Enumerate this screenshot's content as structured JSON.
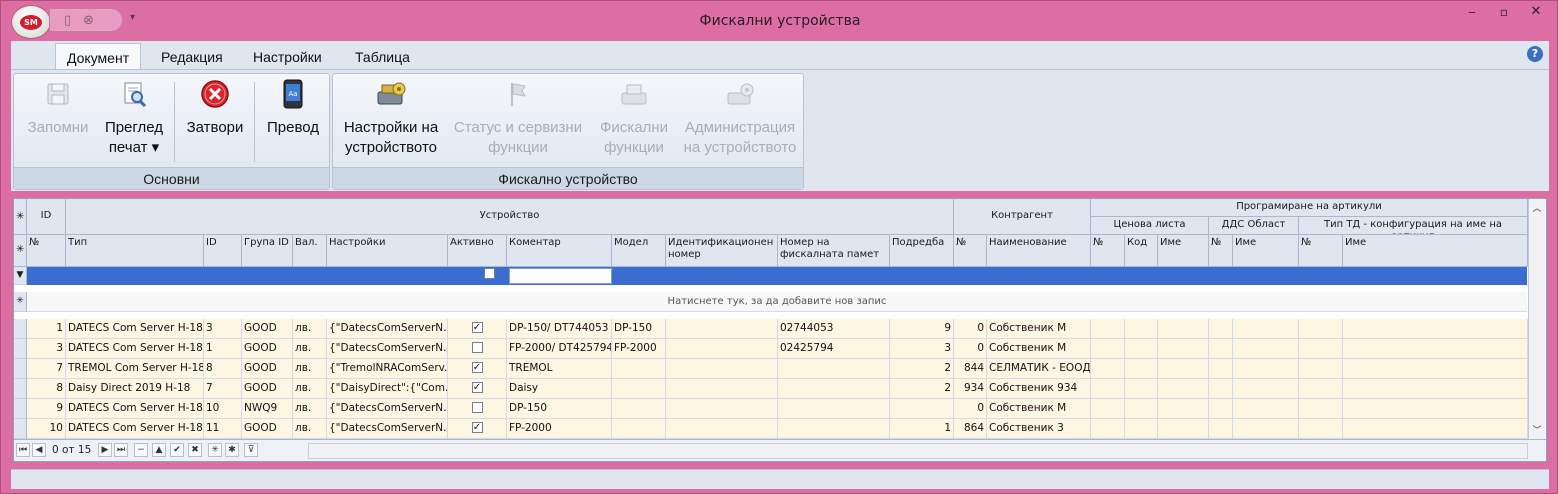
{
  "window": {
    "title": "Фискални устройства",
    "app_badge": "SM"
  },
  "menu_tabs": [
    "Документ",
    "Редакция",
    "Настройки",
    "Таблица"
  ],
  "ribbon": {
    "groups": [
      {
        "title": "Основни",
        "buttons": [
          {
            "label1": "Запомни",
            "label2": "",
            "enabled": false,
            "icon": "save-icon"
          },
          {
            "label1": "Преглед",
            "label2": "печат ▾",
            "enabled": true,
            "icon": "print-preview-icon"
          },
          {
            "label1": "Затвори",
            "label2": "",
            "enabled": true,
            "icon": "close-icon"
          },
          {
            "label1": "Превод",
            "label2": "",
            "enabled": true,
            "icon": "translate-icon"
          }
        ]
      },
      {
        "title": "Фискално устройство",
        "buttons": [
          {
            "label1": "Настройки на",
            "label2": "устройството",
            "enabled": true,
            "icon": "device-settings-icon"
          },
          {
            "label1": "Статус и сервизни",
            "label2": "функции",
            "enabled": false,
            "icon": "flag-icon"
          },
          {
            "label1": "Фискални",
            "label2": "функции",
            "enabled": false,
            "icon": "cash-register-icon"
          },
          {
            "label1": "Администрация",
            "label2": "на устройството",
            "enabled": false,
            "icon": "admin-device-icon"
          }
        ]
      }
    ]
  },
  "grid": {
    "band_headers": {
      "id": "ID",
      "device": "Устройство",
      "counterparty": "Контрагент",
      "article_programming": "Програмиране на артикули",
      "price_list": "Ценова листа",
      "vat_area": "ДДС Област",
      "td_type": "Тип ТД - конфигурация на име на артикул"
    },
    "columns": [
      "№",
      "Тип",
      "ID",
      "Група ID",
      "Вал.",
      "Настройки",
      "Активно",
      "Коментар",
      "Модел",
      "Идентификационен номер",
      "Номер на фискалната памет",
      "Подредба",
      "№",
      "Наименование",
      "№",
      "Код",
      "Име",
      "№",
      "Име",
      "№",
      "Име"
    ],
    "new_row_text": "Натиснете тук, за да добавите нов запис",
    "rows": [
      {
        "no": "1",
        "type": "DATECS Com Server H-18",
        "id": "3",
        "group": "GOOD",
        "cur": "лв.",
        "settings": "{\"DatecsComServerN...",
        "active": true,
        "comment": "DP-150/ DT744053",
        "model": "DP-150",
        "ident": "",
        "fiscal_mem": "02744053",
        "order": "9",
        "cp_no": "0",
        "cp_name": "Собственик М"
      },
      {
        "no": "3",
        "type": "DATECS Com Server H-18",
        "id": "1",
        "group": "GOOD",
        "cur": "лв.",
        "settings": "{\"DatecsComServerN...",
        "active": false,
        "comment": "FP-2000/ DT425794",
        "model": "FP-2000",
        "ident": "",
        "fiscal_mem": "02425794",
        "order": "3",
        "cp_no": "0",
        "cp_name": "Собственик М"
      },
      {
        "no": "7",
        "type": "TREMOL Com Server H-18",
        "id": "8",
        "group": "GOOD",
        "cur": "лв.",
        "settings": "{\"TremolNRAComServ...",
        "active": true,
        "comment": "TREMOL",
        "model": "",
        "ident": "",
        "fiscal_mem": "",
        "order": "2",
        "cp_no": "844",
        "cp_name": "СЕЛМАТИК - ЕООД"
      },
      {
        "no": "8",
        "type": "Daisy Direct 2019 H-18",
        "id": "7",
        "group": "GOOD",
        "cur": "лв.",
        "settings": "{\"DaisyDirect\":{\"Com...",
        "active": true,
        "comment": "Daisy",
        "model": "",
        "ident": "",
        "fiscal_mem": "",
        "order": "2",
        "cp_no": "934",
        "cp_name": "Собственик 934"
      },
      {
        "no": "9",
        "type": "DATECS Com Server H-18",
        "id": "10",
        "group": "NWQ9",
        "cur": "лв.",
        "settings": "{\"DatecsComServerN...",
        "active": false,
        "comment": "DP-150",
        "model": "",
        "ident": "",
        "fiscal_mem": "",
        "order": "",
        "cp_no": "0",
        "cp_name": "Собственик М"
      },
      {
        "no": "10",
        "type": "DATECS Com Server H-18",
        "id": "11",
        "group": "GOOD",
        "cur": "лв.",
        "settings": "{\"DatecsComServerN...",
        "active": true,
        "comment": "FP-2000",
        "model": "",
        "ident": "",
        "fiscal_mem": "",
        "order": "1",
        "cp_no": "864",
        "cp_name": "Собственик 3"
      }
    ],
    "navigator_text": "0 от 15"
  }
}
